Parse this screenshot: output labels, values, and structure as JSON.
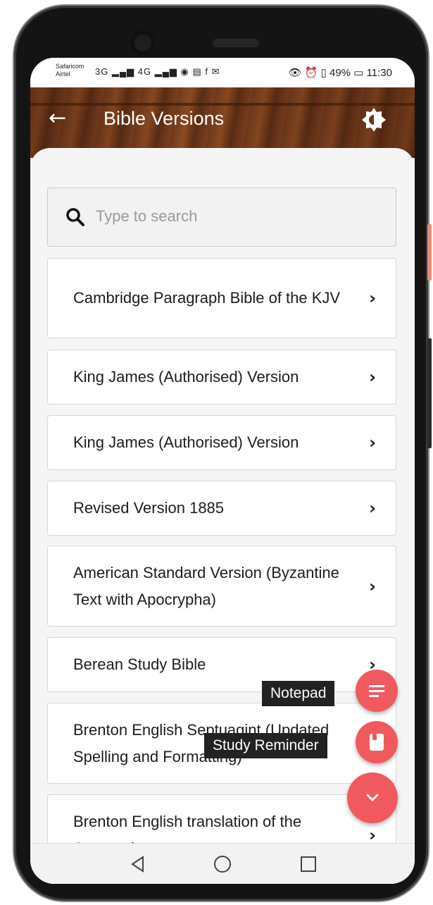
{
  "status_bar": {
    "carrier_1": "Safaricom",
    "carrier_2": "Airtel",
    "left_icons": "3G ▂▄▆ 4G ▂▄▆ ◉ ▤ f ✉",
    "battery": "49%",
    "time": "11:30"
  },
  "header": {
    "title": "Bible Versions",
    "back_icon": "arrow-left-icon",
    "theme_icon": "brightness-icon"
  },
  "search": {
    "placeholder": "Type to search",
    "value": ""
  },
  "versions": [
    {
      "label": "Cambridge Paragraph Bible of the KJV"
    },
    {
      "label": "King James (Authorised) Version"
    },
    {
      "label": "King James (Authorised) Version"
    },
    {
      "label": "Revised Version 1885"
    },
    {
      "label": "American Standard Version (Byzantine Text with Apocrypha)"
    },
    {
      "label": "Berean Study Bible"
    },
    {
      "label": "Brenton English Septuagint (Updated Spelling and Formatting)"
    },
    {
      "label": "Brenton English translation of the Septuagint"
    }
  ],
  "fabs": {
    "notepad_label": "Notepad",
    "reminder_label": "Study Reminder"
  },
  "colors": {
    "accent": "#f05a5f",
    "tooltip_bg": "#222222"
  }
}
